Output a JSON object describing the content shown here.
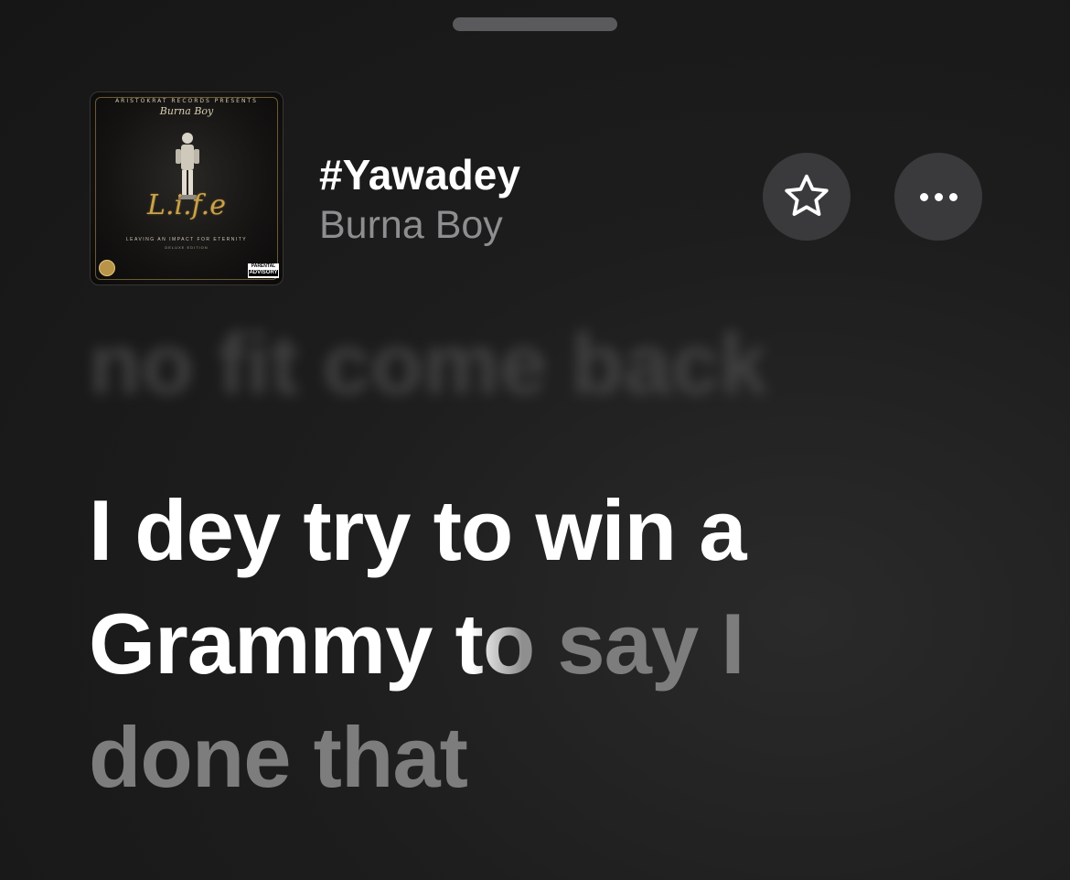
{
  "sheet": {
    "grabber": "drag-handle"
  },
  "album_art": {
    "label_top": "ARISTOKRAT RECORDS PRESENTS",
    "artist_script": "Burna Boy",
    "logo_text": "L.i.f.e",
    "subtitle": "LEAVING AN IMPACT FOR ETERNITY",
    "edition": "DELUXE EDITION",
    "advisory_top": "PARENTAL",
    "advisory_main": "ADVISORY",
    "advisory_bottom": "EXPLICIT CONTENT"
  },
  "track": {
    "title": "#Yawadey",
    "artist": "Burna Boy"
  },
  "actions": {
    "favorite_icon": "star-icon",
    "more_icon": "ellipsis-icon"
  },
  "lyrics": {
    "previous_line": "no fit come back",
    "current_sung": "I dey try to win a Grammy ",
    "current_transition": "to",
    "current_unsung": " say I done that"
  },
  "colors": {
    "background": "#1d1d1d",
    "button_bg": "#3a3a3c",
    "artist_text": "#8e8e90",
    "unsung_lyric": "#7d7d7d"
  }
}
